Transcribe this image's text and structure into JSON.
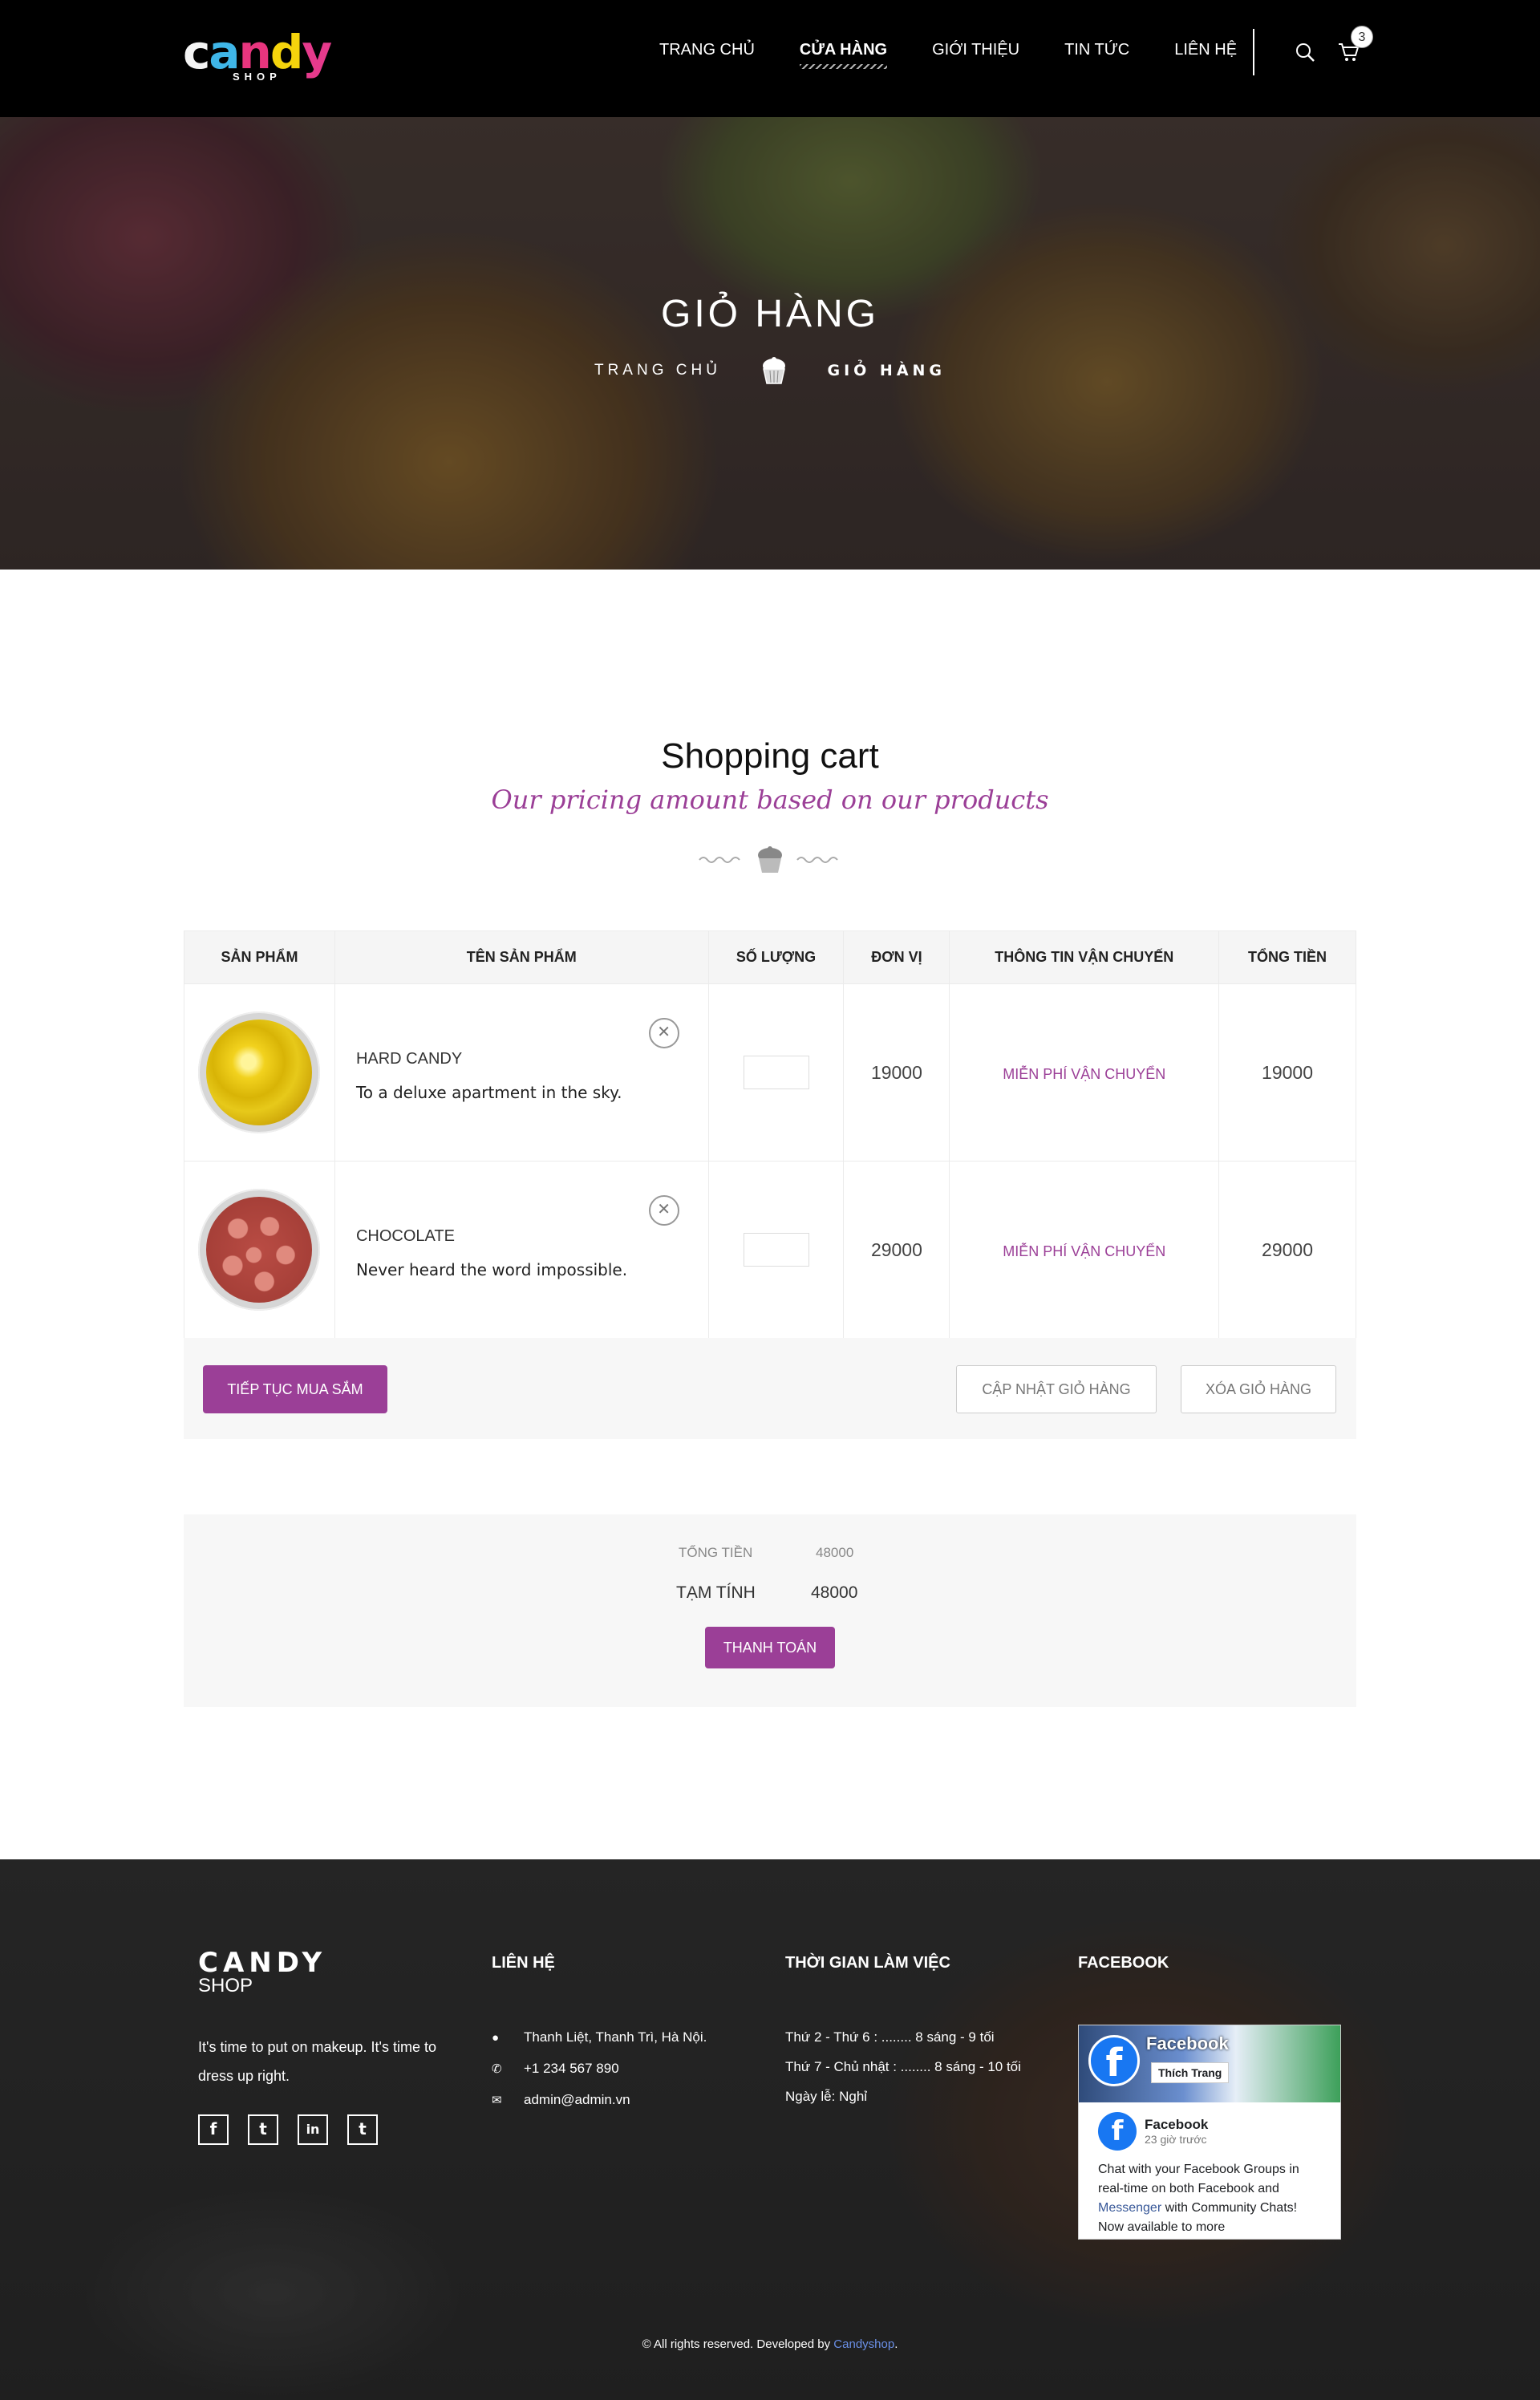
{
  "header": {
    "logo_text": "candy",
    "logo_sub": "SHOP",
    "logo_letter_colors": [
      "#f4f4f4",
      "#3fb6e8",
      "#e8357e",
      "#f5d40c",
      "#e63a8c"
    ],
    "nav": [
      {
        "label": "TRANG CHỦ",
        "active": false
      },
      {
        "label": "CỬA HÀNG",
        "active": true
      },
      {
        "label": "GIỚI THIỆU",
        "active": false
      },
      {
        "label": "TIN TỨC",
        "active": false
      },
      {
        "label": "LIÊN HỆ",
        "active": false
      }
    ],
    "cart_count": "3",
    "icons": {
      "search": "search-icon",
      "cart": "cart-icon"
    }
  },
  "hero": {
    "title": "GIỎ HÀNG",
    "breadcrumb_home": "TRANG CHỦ",
    "breadcrumb_current": "GIỎ HÀNG",
    "separator_icon": "cupcake-icon"
  },
  "section": {
    "title": "Shopping cart",
    "subtitle": "Our pricing amount based on our products"
  },
  "cart": {
    "columns": [
      "SẢN PHẨM",
      "TÊN SẢN PHẨM",
      "SỐ LƯỢNG",
      "ĐƠN VỊ",
      "THÔNG TIN VẬN CHUYẾN",
      "TỔNG TIỀN"
    ],
    "items": [
      {
        "name": "HARD CANDY",
        "description": "To a deluxe apartment in the sky.",
        "quantity": "",
        "unit_price": "19000",
        "shipping": "MIỄN PHÍ VẬN CHUYỂN",
        "total": "19000",
        "remove_icon": "close-icon"
      },
      {
        "name": "CHOCOLATE",
        "description": "Never heard the word impossible.",
        "quantity": "",
        "unit_price": "29000",
        "shipping": "MIỄN PHÍ VẬN CHUYỂN",
        "total": "29000",
        "remove_icon": "close-icon"
      }
    ],
    "actions": {
      "continue": "TIẾP TỤC MUA SẮM",
      "update": "CẬP NHẬT GIỎ HÀNG",
      "clear": "XÓA GIỎ HÀNG"
    }
  },
  "totals": {
    "total_label": "TỔNG TIỀN",
    "total_value": "48000",
    "subtotal_label": "TẠM TÍNH",
    "subtotal_value": "48000",
    "checkout": "THANH TOÁN"
  },
  "footer": {
    "brand_name": "CANDY",
    "brand_sub": "SHOP",
    "brand_text": "It's time to put on makeup. It's time to dress up right.",
    "socials": [
      "f",
      "t",
      "in",
      "t"
    ],
    "contact_heading": "LIÊN HỆ",
    "contact": {
      "address": "Thanh Liệt, Thanh Trì, Hà Nội.",
      "phone": "+1 234 567 890",
      "email": "admin@admin.vn"
    },
    "hours_heading": "THỜI GIAN LÀM VIỆC",
    "hours": [
      "Thứ 2 - Thứ 6 : ........ 8 sáng - 9 tối",
      "Thứ 7 - Chủ nhật : ........ 8 sáng - 10 tối",
      "Ngày lễ: Nghỉ"
    ],
    "facebook_heading": "FACEBOOK",
    "fb_widget": {
      "page_name": "Facebook",
      "like_label": "Thích Trang",
      "post_author": "Facebook",
      "post_time": "23 giờ trước",
      "post_text_1": "Chat with your Facebook Groups in real-time on both Facebook and ",
      "post_link": "Messenger",
      "post_text_2": " with Community Chats! Now available to more"
    },
    "copyright_prefix": "© All rights reserved. Developed by ",
    "copyright_brand": "Candyshop",
    "copyright_suffix": "."
  },
  "colors": {
    "accent": "#9b3f97",
    "header_bg": "#000000",
    "footer_link": "#6a8fe6"
  }
}
